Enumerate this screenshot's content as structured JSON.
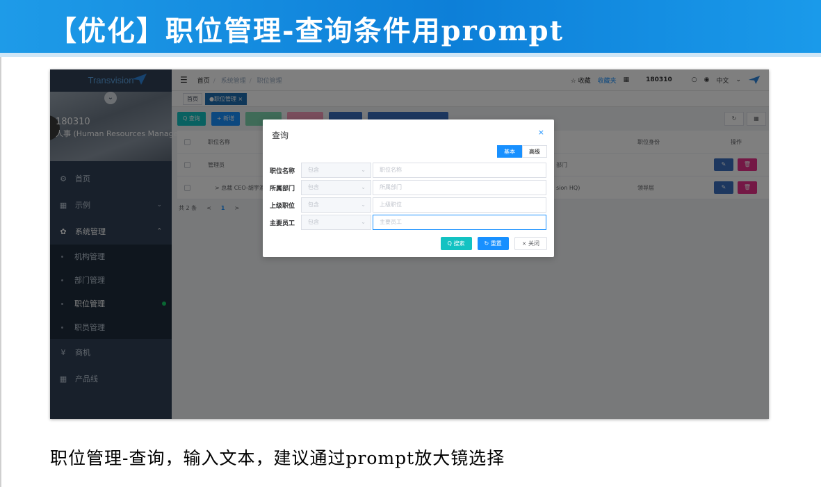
{
  "slide": {
    "title": "【优化】职位管理-查询条件用prompt",
    "caption": "职位管理-查询，输入文本，建议通过prompt放大镜选择"
  },
  "app": {
    "logo": "Transvision",
    "user_id": "180310",
    "user_role": "人事 (Human Resources Manage",
    "menu": [
      {
        "label": "首页",
        "icon": "dashboard-icon"
      },
      {
        "label": "示例",
        "icon": "grid-icon"
      },
      {
        "label": "系统管理",
        "icon": "gear-icon"
      }
    ],
    "submenu": [
      "机构管理",
      "部门管理",
      "职位管理",
      "职员管理"
    ],
    "menu_bottom": [
      {
        "label": "商机",
        "icon": "yen-icon"
      },
      {
        "label": "产品线",
        "icon": "table-icon"
      }
    ],
    "breadcrumb": [
      "首页",
      "系统管理",
      "职位管理"
    ],
    "nav_right": {
      "favorite": "☆ 收藏",
      "favorites": "收藏夹",
      "user": "180310",
      "lang": "中文"
    },
    "tags": [
      "首页",
      "●职位管理 ×"
    ],
    "toolbar": {
      "query": "Q 查询",
      "add": "+ 新增"
    },
    "table": {
      "headers": [
        "职位名称",
        "职位身份",
        "操作"
      ],
      "rows": [
        {
          "name": "管理员",
          "dept": "部门",
          "identity": ""
        },
        {
          "name": "> 总裁 CEO-胡宇澄",
          "dept": "sion HQ)",
          "identity": "领导层"
        }
      ]
    },
    "pager": {
      "total": "共 2 条",
      "prev": "<",
      "page": "1",
      "next": ">"
    },
    "dialog": {
      "title": "查询",
      "close": "×",
      "mode_basic": "基本",
      "mode_advanced": "高级",
      "fields": [
        {
          "label": "职位名称",
          "op": "包含",
          "placeholder": "职位名称"
        },
        {
          "label": "所属部门",
          "op": "包含",
          "placeholder": "所属部门"
        },
        {
          "label": "上级职位",
          "op": "包含",
          "placeholder": "上级职位"
        },
        {
          "label": "主要员工",
          "op": "包含",
          "placeholder": "主要员工"
        }
      ],
      "btn_search": "Q 搜索",
      "btn_reset": "↻ 重置",
      "btn_close": "× 关闭"
    }
  },
  "colors": {
    "banner": "#0d7fd8",
    "sidebar": "#304156",
    "primary": "#1890ff",
    "teal": "#13c2c2",
    "danger": "#e8308a"
  }
}
